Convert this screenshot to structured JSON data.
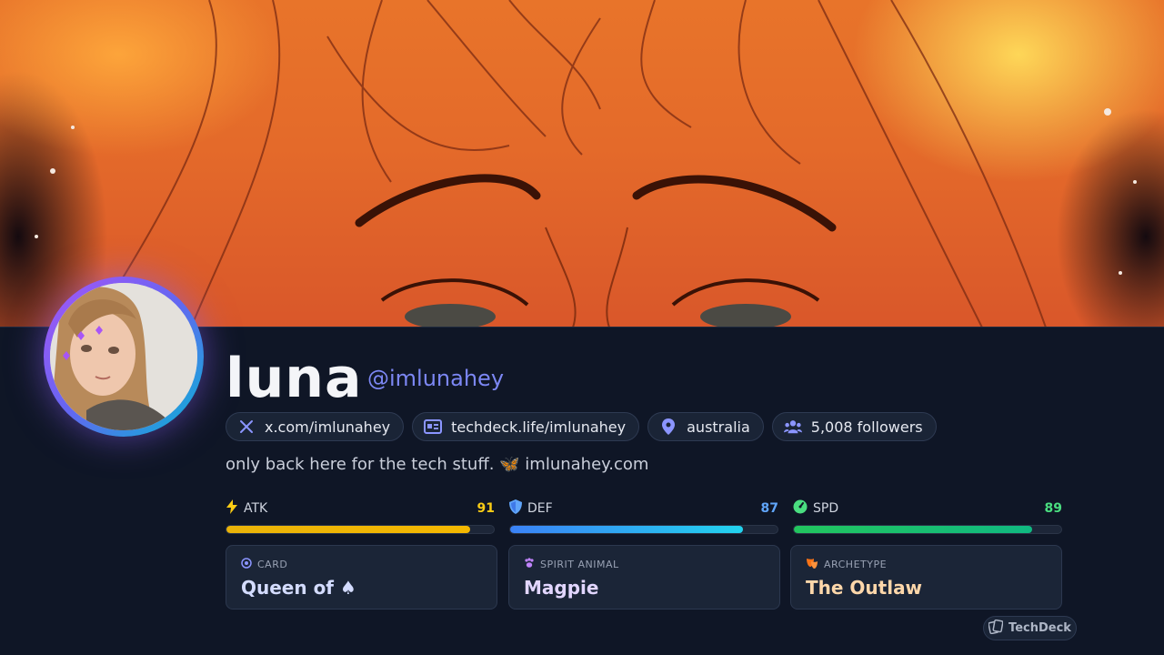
{
  "profile": {
    "name": "luna",
    "handle": "@imlunahey",
    "bio": "only back here for the tech stuff. 🦋 imlunahey.com"
  },
  "links": [
    {
      "icon": "x-logo-icon",
      "label": "x.com/imlunahey"
    },
    {
      "icon": "id-card-icon",
      "label": "techdeck.life/imlunahey"
    },
    {
      "icon": "location-pin-icon",
      "label": "australia"
    },
    {
      "icon": "users-icon",
      "label": "5,008 followers"
    }
  ],
  "stats": [
    {
      "key": "ATK",
      "value": 91,
      "icon": "lightning-icon",
      "color": "#facc15"
    },
    {
      "key": "DEF",
      "value": 87,
      "icon": "shield-icon",
      "color": "#60a5fa"
    },
    {
      "key": "SPD",
      "value": 89,
      "icon": "speed-gauge-icon",
      "color": "#4ade80"
    }
  ],
  "cards": [
    {
      "icon": "target-icon",
      "label": "CARD",
      "value": "Queen of ♠",
      "color": "#d4dcff"
    },
    {
      "icon": "paw-icon",
      "label": "SPIRIT ANIMAL",
      "value": "Magpie",
      "color": "#e2d6ff"
    },
    {
      "icon": "mask-icon",
      "label": "ARCHETYPE",
      "value": "The Outlaw",
      "color": "#fed7aa"
    }
  ],
  "brand": {
    "label": "TechDeck"
  },
  "colors": {
    "background": "#0f1626",
    "accent": "#7c87f4",
    "atk_bar": "#eab308",
    "def_bar": "#3b82f6",
    "spd_bar": "#22c55e"
  }
}
